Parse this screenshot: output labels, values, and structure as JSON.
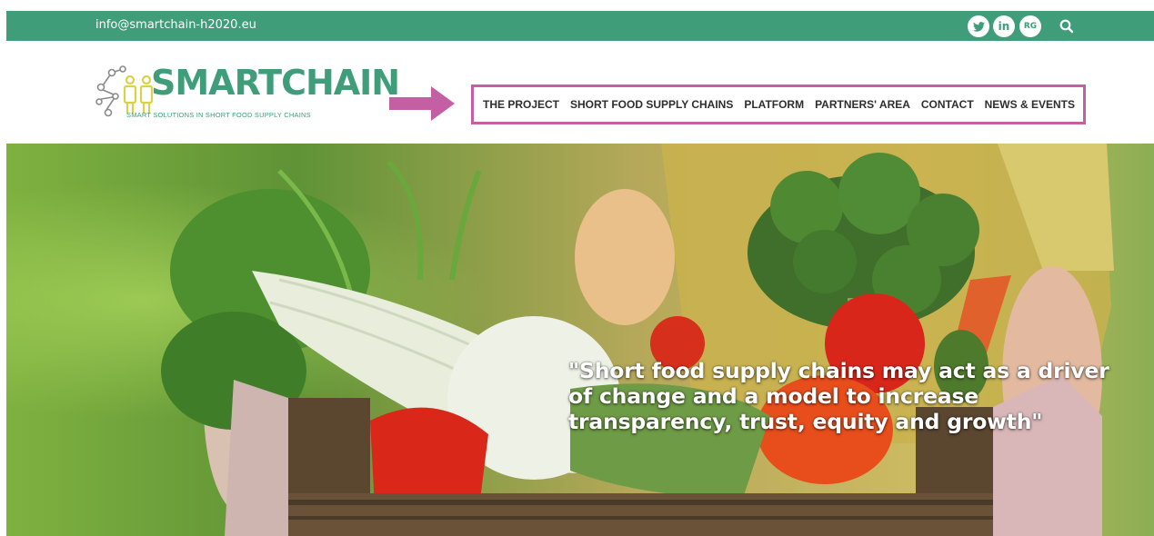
{
  "topbar": {
    "email": "info@smartchain-h2020.eu",
    "social": {
      "twitter_icon": "twitter-icon",
      "linkedin_label": "in",
      "researchgate_label": "RG",
      "search_icon": "search-icon"
    }
  },
  "logo": {
    "word": "SMARTCHAIN",
    "tagline": "SMART SOLUTIONS IN SHORT FOOD SUPPLY CHAINS"
  },
  "nav": {
    "items": [
      {
        "label": "THE PROJECT"
      },
      {
        "label": "SHORT FOOD SUPPLY CHAINS"
      },
      {
        "label": "PLATFORM"
      },
      {
        "label": "PARTNERS' AREA"
      },
      {
        "label": "CONTACT"
      },
      {
        "label": "NEWS & EVENTS"
      }
    ]
  },
  "hero": {
    "quote": "\"Short food supply chains may act as a driver of change and a model to increase transparency, trust, equity and growth\""
  },
  "colors": {
    "brand_green": "#3f9d79",
    "highlight_magenta": "#c55fa4",
    "nav_text": "#2e2e2e",
    "hero_text": "#ffffff"
  }
}
